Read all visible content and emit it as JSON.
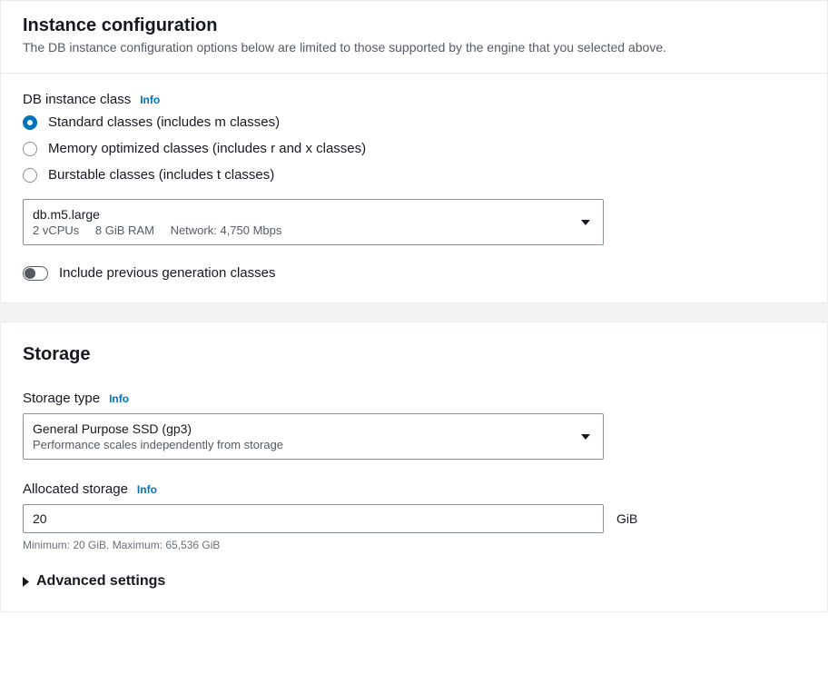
{
  "instance": {
    "title": "Instance configuration",
    "subtitle": "The DB instance configuration options below are limited to those supported by the engine that you selected above.",
    "class_label": "DB instance class",
    "info": "Info",
    "radio_options": {
      "standard": "Standard classes (includes m classes)",
      "memory": "Memory optimized classes (includes r and x classes)",
      "burstable": "Burstable classes (includes t classes)"
    },
    "dropdown": {
      "value": "db.m5.large",
      "vcpu": "2 vCPUs",
      "ram": "8 GiB RAM",
      "network": "Network: 4,750 Mbps"
    },
    "toggle_label": "Include previous generation classes"
  },
  "storage": {
    "title": "Storage",
    "type_label": "Storage type",
    "info": "Info",
    "dropdown": {
      "value": "General Purpose SSD (gp3)",
      "sub": "Performance scales independently from storage"
    },
    "allocated_label": "Allocated storage",
    "allocated_value": "20",
    "unit": "GiB",
    "hint": "Minimum: 20 GiB. Maximum: 65,536 GiB",
    "advanced": "Advanced settings"
  }
}
